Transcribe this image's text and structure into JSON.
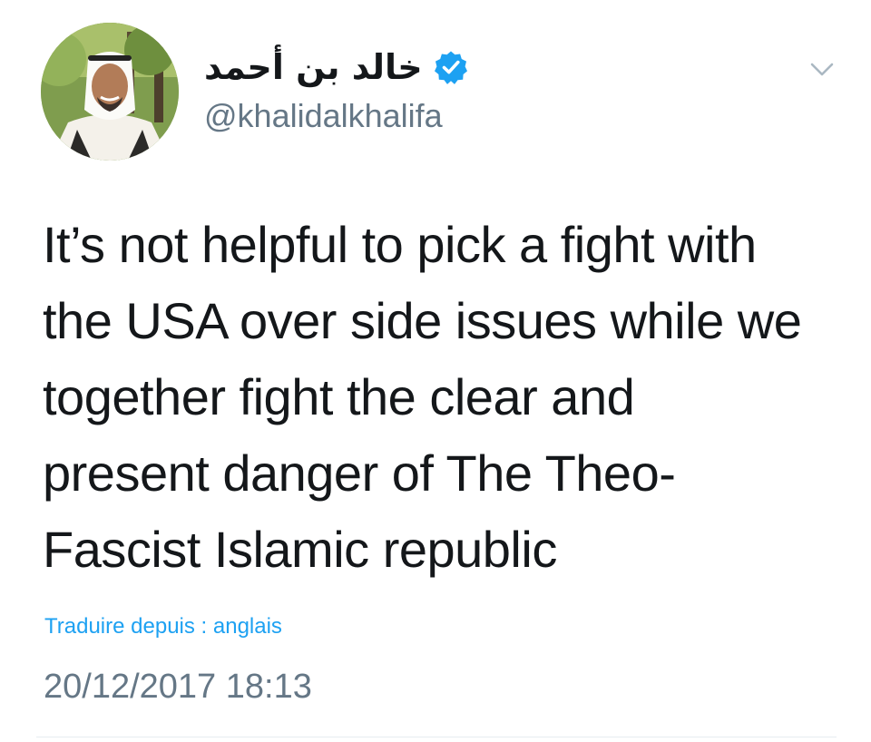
{
  "author": {
    "display_name": "خالد بن أحمد",
    "handle": "@khalidalkhalifa",
    "verified": true,
    "avatar_icon": "profile-photo-avatar"
  },
  "tweet": {
    "text_lines": [
      "It’s not helpful to pick a fight with",
      "the USA over side issues while we",
      "together fight the clear and",
      "present danger of The Theo-",
      "Fascist Islamic republic"
    ],
    "translate_label": "Traduire depuis : anglais",
    "timestamp": "20/12/2017 18:13"
  },
  "icons": {
    "verified": "verified-badge-icon",
    "menu": "chevron-down-icon"
  },
  "colors": {
    "text": "#14171a",
    "secondary": "#657786",
    "link": "#1da1f2",
    "verified": "#1da1f2",
    "divider": "#e6ecf0"
  }
}
